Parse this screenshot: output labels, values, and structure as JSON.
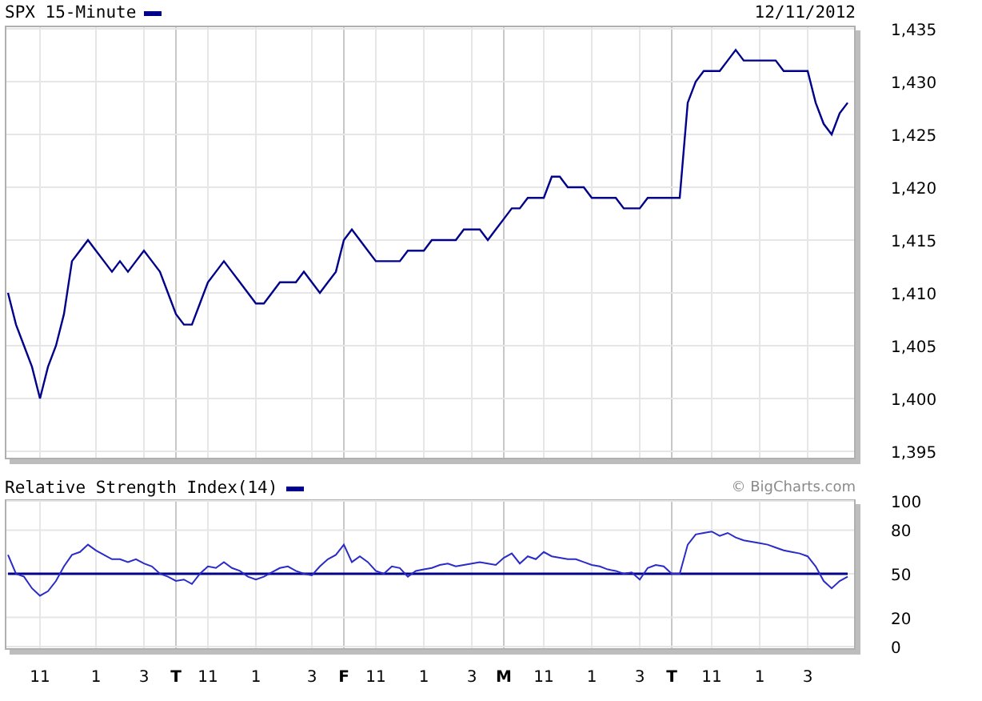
{
  "price_chart": {
    "date": "12/11/2012",
    "chart_data": {
      "type": "line",
      "grid": true,
      "ylim": [
        1395,
        1435
      ],
      "categories": [
        null,
        null,
        null,
        null,
        null,
        null,
        null,
        null,
        null,
        null,
        null,
        null,
        null,
        null,
        null,
        null,
        null,
        null,
        null,
        null,
        null,
        null,
        null,
        null,
        null,
        null,
        null,
        null,
        null,
        null,
        null,
        null,
        null,
        null,
        null,
        null,
        null,
        null,
        null,
        null,
        null,
        null,
        null,
        null,
        null,
        null,
        null,
        null,
        null,
        null,
        null,
        null,
        null,
        null,
        null,
        null,
        null,
        null,
        null,
        null,
        null,
        null,
        null,
        null,
        null,
        null,
        null,
        null,
        null,
        null,
        null,
        null,
        null,
        null,
        null,
        null,
        null,
        null,
        null,
        null,
        null,
        null,
        null,
        null,
        null,
        null,
        null,
        null,
        null,
        null,
        null,
        null,
        null,
        null,
        null,
        null,
        null,
        null,
        null,
        null,
        null,
        null,
        null,
        null,
        null,
        null
      ],
      "series": [
        {
          "name": "SPX 15-Minute",
          "color": "#00008b",
          "values": [
            1410,
            1407,
            1405,
            1403,
            1400,
            1403,
            1405,
            1408,
            1413,
            1414,
            1415,
            1414,
            1413,
            1412,
            1413,
            1412,
            1413,
            1414,
            1413,
            1412,
            1410,
            1408,
            1407,
            1407,
            1409,
            1411,
            1412,
            1413,
            1412,
            1411,
            1410,
            1409,
            1409,
            1410,
            1411,
            1411,
            1411,
            1412,
            1411,
            1410,
            1411,
            1412,
            1415,
            1416,
            1415,
            1414,
            1413,
            1413,
            1413,
            1413,
            1414,
            1414,
            1414,
            1415,
            1415,
            1415,
            1415,
            1416,
            1416,
            1416,
            1415,
            1416,
            1417,
            1418,
            1418,
            1419,
            1419,
            1419,
            1421,
            1421,
            1420,
            1420,
            1420,
            1419,
            1419,
            1419,
            1419,
            1418,
            1418,
            1418,
            1419,
            1419,
            1419,
            1419,
            1419,
            1428,
            1430,
            1431,
            1431,
            1431,
            1432,
            1433,
            1432,
            1432,
            1432,
            1432,
            1432,
            1431,
            1431,
            1431,
            1431,
            1428,
            1426,
            1425,
            1427,
            1428
          ]
        }
      ],
      "yticks": [
        {
          "value": 1435,
          "label": "1,435"
        },
        {
          "value": 1430,
          "label": "1,430"
        },
        {
          "value": 1425,
          "label": "1,425"
        },
        {
          "value": 1420,
          "label": "1,420"
        },
        {
          "value": 1415,
          "label": "1,415"
        },
        {
          "value": 1410,
          "label": "1,410"
        },
        {
          "value": 1405,
          "label": "1,405"
        },
        {
          "value": 1400,
          "label": "1,400"
        },
        {
          "value": 1395,
          "label": "1,395"
        }
      ]
    }
  },
  "rsi_chart": {
    "credit": "© BigCharts.com",
    "chart_data": {
      "type": "line",
      "grid": true,
      "ylim": [
        0,
        100
      ],
      "categories": [
        null,
        null,
        null,
        null,
        "11",
        null,
        null,
        null,
        null,
        null,
        null,
        "1",
        null,
        null,
        null,
        null,
        null,
        "3",
        null,
        null,
        null,
        "T",
        null,
        null,
        null,
        "11",
        null,
        null,
        null,
        null,
        null,
        "1",
        null,
        null,
        null,
        null,
        null,
        null,
        "3",
        null,
        null,
        null,
        "F",
        null,
        null,
        null,
        "11",
        null,
        null,
        null,
        null,
        null,
        "1",
        null,
        null,
        null,
        null,
        null,
        "3",
        null,
        null,
        null,
        "M",
        null,
        null,
        null,
        null,
        "11",
        null,
        null,
        null,
        null,
        null,
        "1",
        null,
        null,
        null,
        null,
        null,
        "3",
        null,
        null,
        null,
        "T",
        null,
        null,
        null,
        null,
        "11",
        null,
        null,
        null,
        null,
        null,
        "1",
        null,
        null,
        null,
        null,
        null,
        "3",
        null,
        null,
        null,
        null,
        null
      ],
      "series": [
        {
          "name": "Relative Strength Index(14)",
          "color": "#2b2bc8",
          "values": [
            63,
            50,
            48,
            40,
            35,
            38,
            45,
            55,
            63,
            65,
            70,
            66,
            63,
            60,
            60,
            58,
            60,
            57,
            55,
            50,
            48,
            45,
            46,
            43,
            50,
            55,
            54,
            58,
            54,
            52,
            48,
            46,
            48,
            51,
            54,
            55,
            52,
            50,
            49,
            55,
            60,
            63,
            70,
            58,
            62,
            58,
            52,
            50,
            55,
            54,
            48,
            52,
            53,
            54,
            56,
            57,
            55,
            56,
            57,
            58,
            57,
            56,
            61,
            64,
            57,
            62,
            60,
            65,
            62,
            61,
            60,
            60,
            58,
            56,
            55,
            53,
            52,
            50,
            51,
            46,
            54,
            56,
            55,
            50,
            50,
            70,
            77,
            78,
            79,
            76,
            78,
            75,
            73,
            72,
            71,
            70,
            68,
            66,
            65,
            64,
            62,
            55,
            45,
            40,
            45,
            48
          ]
        },
        {
          "color": "#00008b",
          "values": [
            50,
            50,
            50,
            50,
            50,
            50,
            50,
            50,
            50,
            50,
            50,
            50,
            50,
            50,
            50,
            50,
            50,
            50,
            50,
            50,
            50,
            50,
            50,
            50,
            50,
            50,
            50,
            50,
            50,
            50,
            50,
            50,
            50,
            50,
            50,
            50,
            50,
            50,
            50,
            50,
            50,
            50,
            50,
            50,
            50,
            50,
            50,
            50,
            50,
            50,
            50,
            50,
            50,
            50,
            50,
            50,
            50,
            50,
            50,
            50,
            50,
            50,
            50,
            50,
            50,
            50,
            50,
            50,
            50,
            50,
            50,
            50,
            50,
            50,
            50,
            50,
            50,
            50,
            50,
            50,
            50,
            50,
            50,
            50,
            50,
            50,
            50,
            50,
            50,
            50,
            50,
            50,
            50,
            50,
            50,
            50,
            50,
            50,
            50,
            50,
            50,
            50,
            50,
            50,
            50,
            50
          ]
        }
      ],
      "yticks": [
        100,
        80,
        50,
        20,
        0
      ]
    }
  }
}
